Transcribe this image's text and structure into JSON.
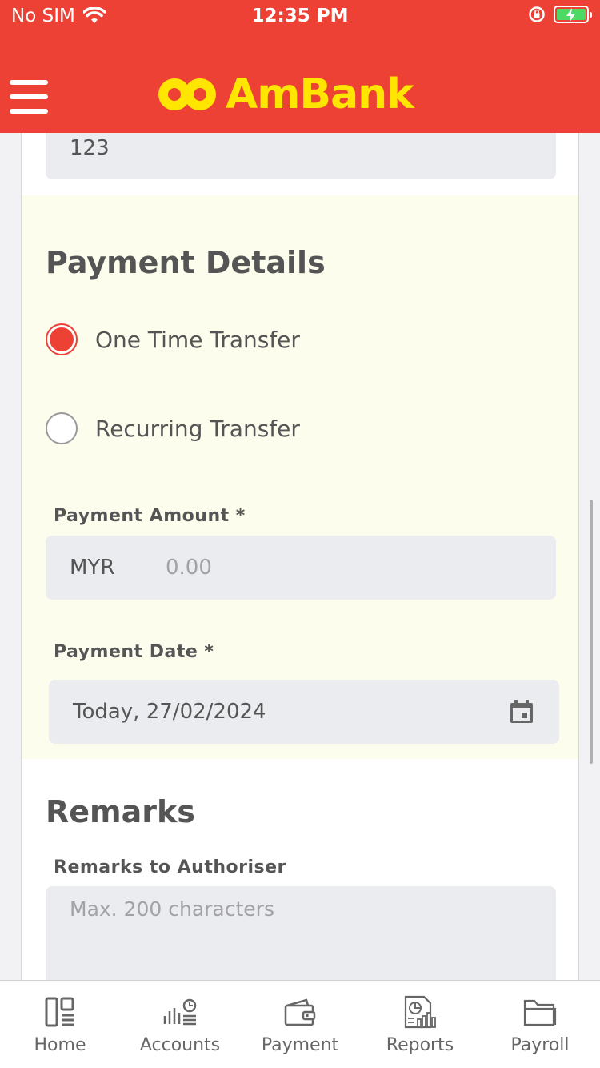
{
  "status_bar": {
    "carrier": "No SIM",
    "time": "12:35 PM"
  },
  "header": {
    "brand": "AmBank",
    "brand_color": "#ffe600",
    "background_color": "#ec4134"
  },
  "form": {
    "top_field_value": "123",
    "payment_details": {
      "title": "Payment Details",
      "options": [
        {
          "label": "One Time Transfer",
          "selected": true
        },
        {
          "label": "Recurring Transfer",
          "selected": false
        }
      ],
      "amount_label": "Payment Amount *",
      "currency": "MYR",
      "amount_placeholder": "0.00",
      "date_label": "Payment Date *",
      "date_value": "Today, 27/02/2024"
    },
    "remarks": {
      "title": "Remarks",
      "label": "Remarks to Authoriser",
      "placeholder": "Max. 200 characters"
    }
  },
  "tabbar": {
    "items": [
      {
        "label": "Home",
        "icon": "home-icon"
      },
      {
        "label": "Accounts",
        "icon": "accounts-icon"
      },
      {
        "label": "Payment",
        "icon": "wallet-icon"
      },
      {
        "label": "Reports",
        "icon": "reports-icon"
      },
      {
        "label": "Payroll",
        "icon": "folder-icon"
      }
    ]
  }
}
